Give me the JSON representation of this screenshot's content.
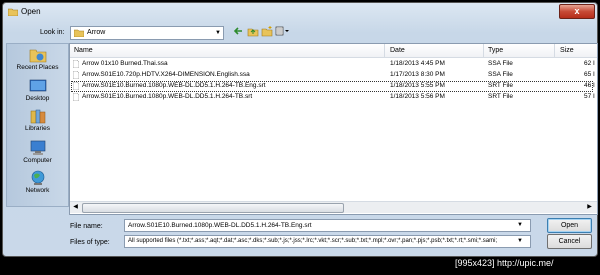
{
  "window": {
    "title": "Open",
    "close_glyph": "x"
  },
  "look_in": {
    "label": "Look in:",
    "value": "Arrow"
  },
  "places": [
    {
      "label": "Recent Places",
      "icon": "recent-places-icon"
    },
    {
      "label": "Desktop",
      "icon": "desktop-icon"
    },
    {
      "label": "Libraries",
      "icon": "libraries-icon"
    },
    {
      "label": "Computer",
      "icon": "computer-icon"
    },
    {
      "label": "Network",
      "icon": "network-icon"
    }
  ],
  "columns": {
    "name": "Name",
    "date": "Date",
    "type": "Type",
    "size": "Size"
  },
  "files": [
    {
      "name": "Arrow 01x10 Burned.Thai.ssa",
      "date": "1/18/2013 4:45 PM",
      "type": "SSA File",
      "size": "62 I",
      "selected": false
    },
    {
      "name": "Arrow.S01E10.720p.HDTV.X264-DIMENSION.English.ssa",
      "date": "1/17/2013 8:30 PM",
      "type": "SSA File",
      "size": "65 I",
      "selected": false
    },
    {
      "name": "Arrow.S01E10.Burned.1080p.WEB-DL.DD5.1.H.264-TB.Eng.srt",
      "date": "1/18/2013 5:55 PM",
      "type": "SRT File",
      "size": "46 I",
      "selected": true
    },
    {
      "name": "Arrow.S01E10.Burned.1080p.WEB-DL.DD5.1.H.264-TB.srt",
      "date": "1/18/2013 5:56 PM",
      "type": "SRT File",
      "size": "57 I",
      "selected": false
    }
  ],
  "file_name": {
    "label": "File name:",
    "value": "Arrow.S01E10.Burned.1080p.WEB-DL.DD5.1.H.264-TB.Eng.srt"
  },
  "file_type": {
    "label": "Files of type:",
    "value": "All supported files (*.txt;*.ass;*.aqt;*.dat;*.asc;*.dks;*.sub;*.js;*.jss;*.lrc;*.vkt;*.scr;*.sub;*.txt;*.mpl;*.ovr;*.pan;*.pjs;*.psb;*.txt;*.rt;*.smi;*.sami;"
  },
  "buttons": {
    "open": "Open",
    "cancel": "Cancel"
  },
  "watermark": "[995x423] http://upic.me/",
  "colors": {
    "selection_border": "#333333",
    "title_close": "#c74a36",
    "places_bg": "#b5c8dd"
  }
}
